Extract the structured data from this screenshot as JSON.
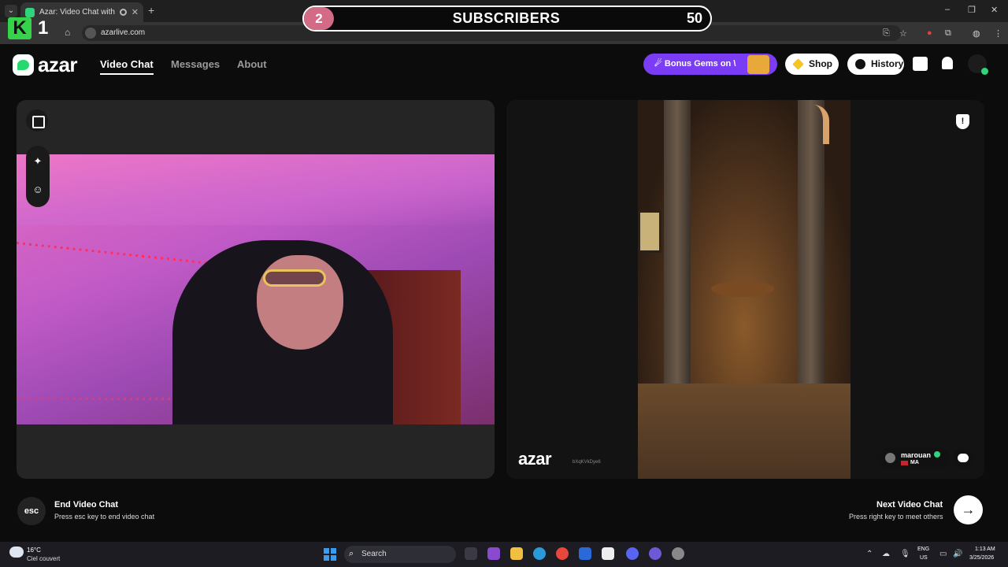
{
  "browser": {
    "tab_title": "Azar: Video Chat with New",
    "new_tab": "+",
    "url": "azarlive.com",
    "window_controls": [
      "–",
      "❐",
      "✕"
    ]
  },
  "overlay": {
    "logo_letter": "K",
    "logo_number": "1",
    "sub_current": "2",
    "sub_label": "SUBSCRIBERS",
    "sub_goal": "50"
  },
  "header": {
    "logo": "azar",
    "nav": [
      "Video Chat",
      "Messages",
      "About"
    ],
    "bonus": "☄ Bonus Gems on \\",
    "shop": "Shop",
    "history": "History"
  },
  "remote": {
    "watermark": "azar",
    "session_id": "bXqKVkDye6",
    "peer_name": "marouan",
    "peer_country": "MA",
    "report_glyph": "!"
  },
  "footer": {
    "esc_key": "esc",
    "end_title": "End Video Chat",
    "end_sub": "Press esc key to end video chat",
    "next_title": "Next Video Chat",
    "next_sub": "Press right key to meet others",
    "next_arrow": "→"
  },
  "taskbar": {
    "temp": "16°C",
    "weather": "Ciel couvert",
    "search": "Search",
    "lang1": "ENG",
    "lang2": "US",
    "time": "1:13 AM",
    "date": "3/25/2026"
  },
  "colors": {
    "accent_green": "#2fd47c",
    "bonus_purple": "#7b3cf5",
    "subscriber_pink": "#d36a86"
  }
}
